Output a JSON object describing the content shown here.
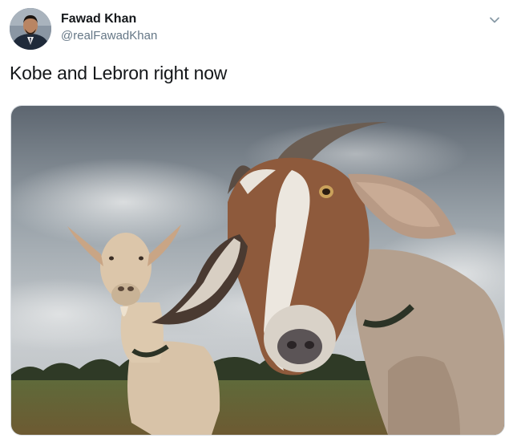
{
  "tweet": {
    "author": {
      "display_name": "Fawad Khan",
      "handle": "@realFawadKhan",
      "avatar_icon": "profile-photo"
    },
    "text": "Kobe and Lebron right now",
    "menu_icon": "chevron-down-icon",
    "media": {
      "type": "photo",
      "subject": "two goats in a field under a cloudy sky"
    }
  },
  "colors": {
    "name": "#14171a",
    "handle": "#657786",
    "chevron": "#8899a6"
  }
}
